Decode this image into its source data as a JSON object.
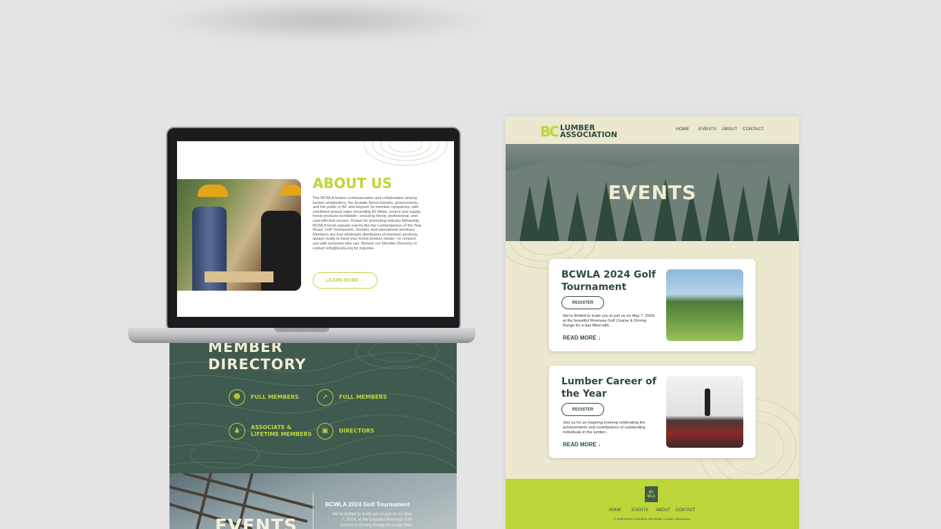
{
  "laptop_page": {
    "about_title": "ABOUT US",
    "about_body": "The BCWLA fosters communication and collaboration among lumber wholesalers, the broader forest industry, governments, and the public in BC and beyond. Its member companies, with combined annual sales exceeding $2 billion, source and supply forest products worldwide—ensuring timely, professional, and cost-effective service. Known for promoting industry fellowship, BCWLA hosts popular events like the Lumberperson of the Year Roast, Golf Tournament, Smoker, and educational seminars. Members are true wholesale distributors of premium products, always ready to meet your forest product needs—or connect you with someone who can. Browse our Member Directory or contact info@bcwla.org for inquiries.",
    "learn_more": "LEARN MORE →"
  },
  "member_directory": {
    "title_line1": "MEMBER",
    "title_line2": "DIRECTORY",
    "items": [
      {
        "label": "FULL MEMBERS",
        "icon": "group-icon"
      },
      {
        "label": "FULL MEMBERS",
        "icon": "compass-icon"
      },
      {
        "label_line1": "ASSOCIATE &",
        "label_line2": "LIFETIME MEMBERS",
        "icon": "person-icon"
      },
      {
        "label": "DIRECTORS",
        "icon": "briefcase-icon"
      }
    ]
  },
  "events_strip": {
    "title": "EVENTS",
    "event_title": "BCWLA 2024 Golf Tournament",
    "event_desc": "We're thrilled to invite you to join us on May 7, 2024, at the beautiful Riverway Golf Course & Driving Range for a day filled"
  },
  "right_page": {
    "logo_bc": "BC",
    "logo_line1": "LUMBER",
    "logo_line2": "ASSOCIATION",
    "nav": [
      "HOME",
      "EVENTS",
      "ABOUT",
      "CONTACT"
    ],
    "hero_title": "EVENTS",
    "cards": [
      {
        "title": "BCWLA 2024 Golf Tournament",
        "register": "REGISTER",
        "desc": "We're thrilled to invite you to join us on May 7, 2024, at the beautiful Riverway Golf Course & Driving Range for a day filled with...",
        "read_more": "READ MORE ↓"
      },
      {
        "title": "Lumber Career of the Year",
        "register": "REGISTER",
        "desc": "Join us for an inspiring evening celebrating the achievements and contributions of outstanding individuals in the lumber...",
        "read_more": "READ MORE ↓"
      }
    ],
    "footer": {
      "logo": "BC WLA",
      "nav": [
        "HOME",
        "EVENTS",
        "ABOUT",
        "CONTACT"
      ],
      "copyright": "© 2025 British Columbia Wholesale Lumber Association."
    }
  },
  "colors": {
    "accent_lime": "#bcd63a",
    "forest_green": "#3f5a4e",
    "cream": "#ebe8cf"
  }
}
